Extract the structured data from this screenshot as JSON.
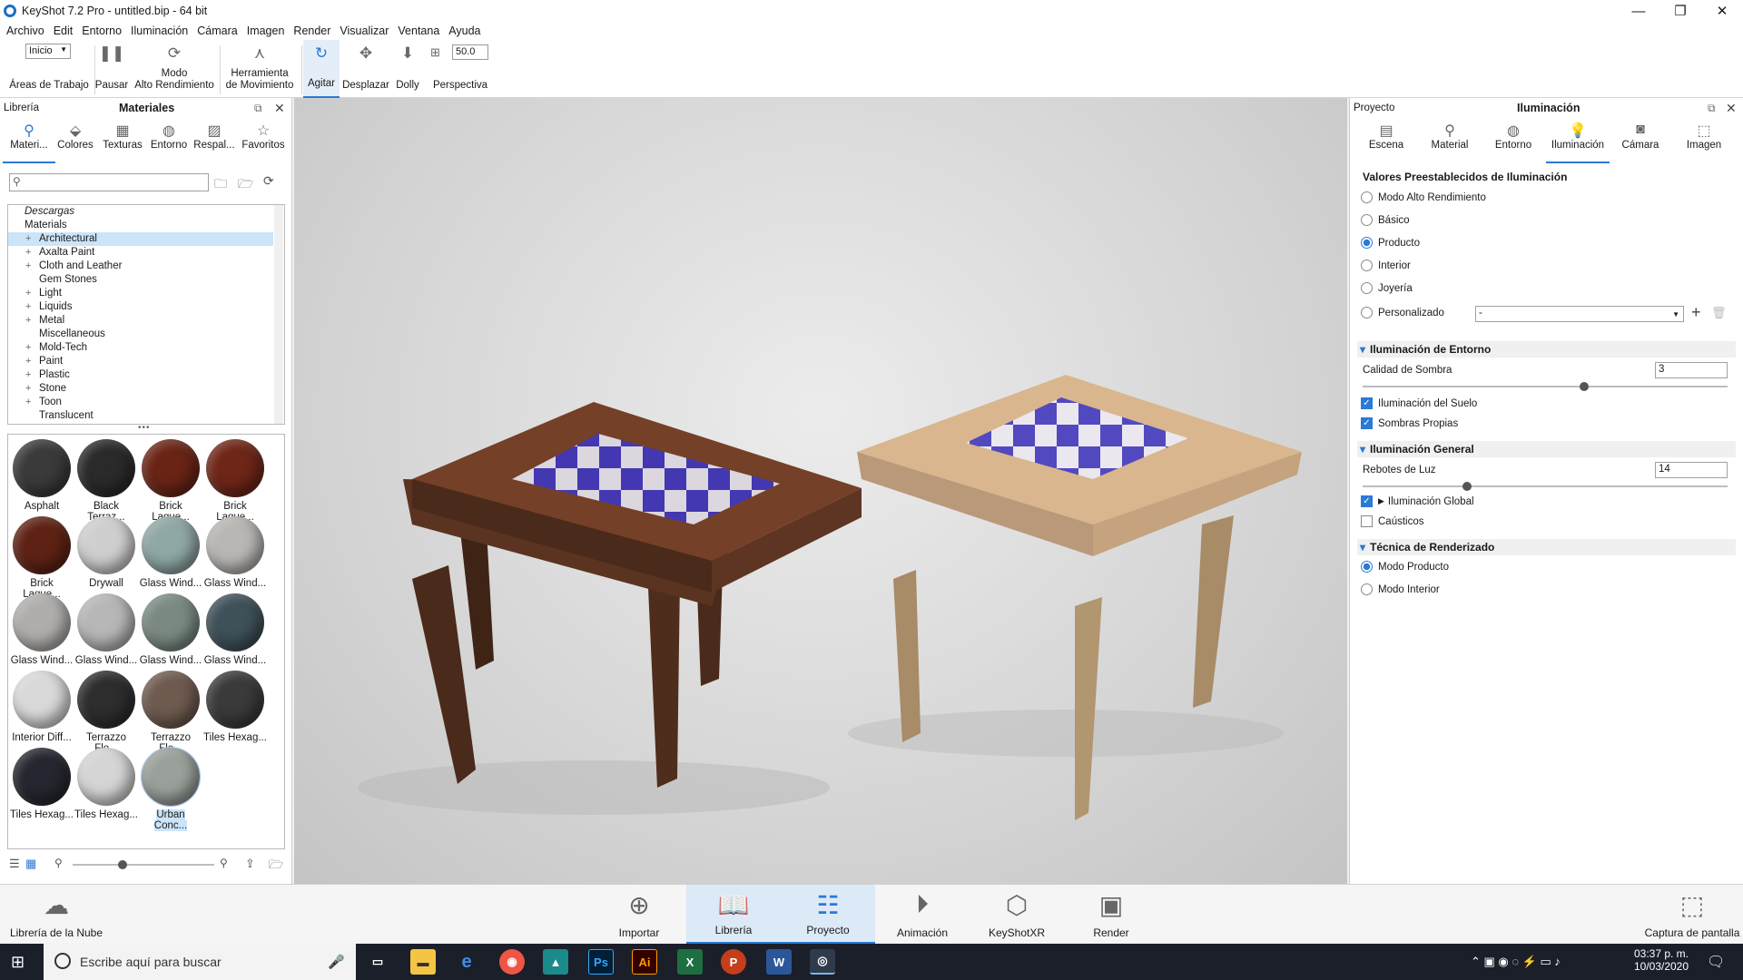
{
  "window": {
    "title": "KeyShot 7.2 Pro - untitled.bip - 64 bit"
  },
  "menu": [
    "Archivo",
    "Edit",
    "Entorno",
    "Iluminación",
    "Cámara",
    "Imagen",
    "Render",
    "Visualizar",
    "Ventana",
    "Ayuda"
  ],
  "toolbar": {
    "workspace_select": "Inicio",
    "workspace_label": "Áreas de Trabajo",
    "pause": "Pausar",
    "perf_mode_1": "Modo",
    "perf_mode_2": "Alto Rendimiento",
    "move_tool_1": "Herramienta",
    "move_tool_2": "de Movimiento",
    "tumble": "Agitar",
    "pan": "Desplazar",
    "dolly": "Dolly",
    "fov_value": "50.0",
    "perspective": "Perspectiva"
  },
  "left_panel": {
    "left_title": "Librería",
    "title": "Materiales",
    "tabs": [
      "Materi...",
      "Colores",
      "Texturas",
      "Entorno",
      "Respal...",
      "Favoritos"
    ],
    "search_placeholder": "",
    "tree": {
      "downloads": "Descargas",
      "root": "Materials",
      "items": [
        "Architectural",
        "Axalta Paint",
        "Cloth and Leather",
        "Gem Stones",
        "Light",
        "Liquids",
        "Metal",
        "Miscellaneous",
        "Mold-Tech",
        "Paint",
        "Plastic",
        "Stone",
        "Toon",
        "Translucent"
      ]
    },
    "materials": [
      {
        "name": "Asphalt",
        "color": "#3a3a3a"
      },
      {
        "name": "Black Terraz...",
        "color": "#2a2a2a"
      },
      {
        "name": "Brick Laque...",
        "color": "#6a2416"
      },
      {
        "name": "Brick Laque...",
        "color": "#6e2617"
      },
      {
        "name": "Brick Laque...",
        "color": "#5e2214"
      },
      {
        "name": "Drywall",
        "color": "#cfcfcf"
      },
      {
        "name": "Glass Wind...",
        "color": "#8fa7a5"
      },
      {
        "name": "Glass Wind...",
        "color": "#b9b6b3"
      },
      {
        "name": "Glass Wind...",
        "color": "#b0aeac"
      },
      {
        "name": "Glass Wind...",
        "color": "#b7b7b7"
      },
      {
        "name": "Glass Wind...",
        "color": "#7a8a82"
      },
      {
        "name": "Glass Wind...",
        "color": "#3e5058"
      },
      {
        "name": "Interior Diff...",
        "color": "#d9d9d9"
      },
      {
        "name": "Terrazzo Flo...",
        "color": "#2d2d2d"
      },
      {
        "name": "Terrazzo Flo...",
        "color": "#6e5a4e"
      },
      {
        "name": "Tiles Hexag...",
        "color": "#3a3a3a"
      },
      {
        "name": "Tiles Hexag...",
        "color": "#262630"
      },
      {
        "name": "Tiles Hexag...",
        "color": "#d5d5d5"
      },
      {
        "name": "Urban Conc...",
        "color": "#9aa09a"
      }
    ]
  },
  "right_panel": {
    "left_title": "Proyecto",
    "title": "Iluminación",
    "tabs": [
      "Escena",
      "Material",
      "Entorno",
      "Iluminación",
      "Cámara",
      "Imagen"
    ],
    "presets_title": "Valores Preestablecidos de Iluminación",
    "presets": [
      "Modo Alto Rendimiento",
      "Básico",
      "Producto",
      "Interior",
      "Joyería",
      "Personalizado"
    ],
    "custom_select": "-",
    "env_section": "Iluminación de Entorno",
    "shadow_quality_label": "Calidad de Sombra",
    "shadow_quality_value": "3",
    "shadow_quality_level": 0.61,
    "ground_illum": "Iluminación del Suelo",
    "self_shadows": "Sombras Propias",
    "general_section": "Iluminación General",
    "bounces_label": "Rebotes de Luz",
    "bounces_value": "14",
    "bounces_level": 0.28,
    "global_illum": "Iluminación Global",
    "caustics": "Caústicos",
    "render_section": "Técnica de Renderizado",
    "render_modes": [
      "Modo Producto",
      "Modo Interior"
    ]
  },
  "bottom": {
    "cloud": "Librería de la Nube",
    "items": [
      "Importar",
      "Librería",
      "Proyecto",
      "Animación",
      "KeyShotXR",
      "Render"
    ],
    "capture": "Captura de pantalla"
  },
  "taskbar": {
    "search": "Escribe aquí para buscar",
    "time": "03:37 p. m.",
    "date": "10/03/2020"
  }
}
